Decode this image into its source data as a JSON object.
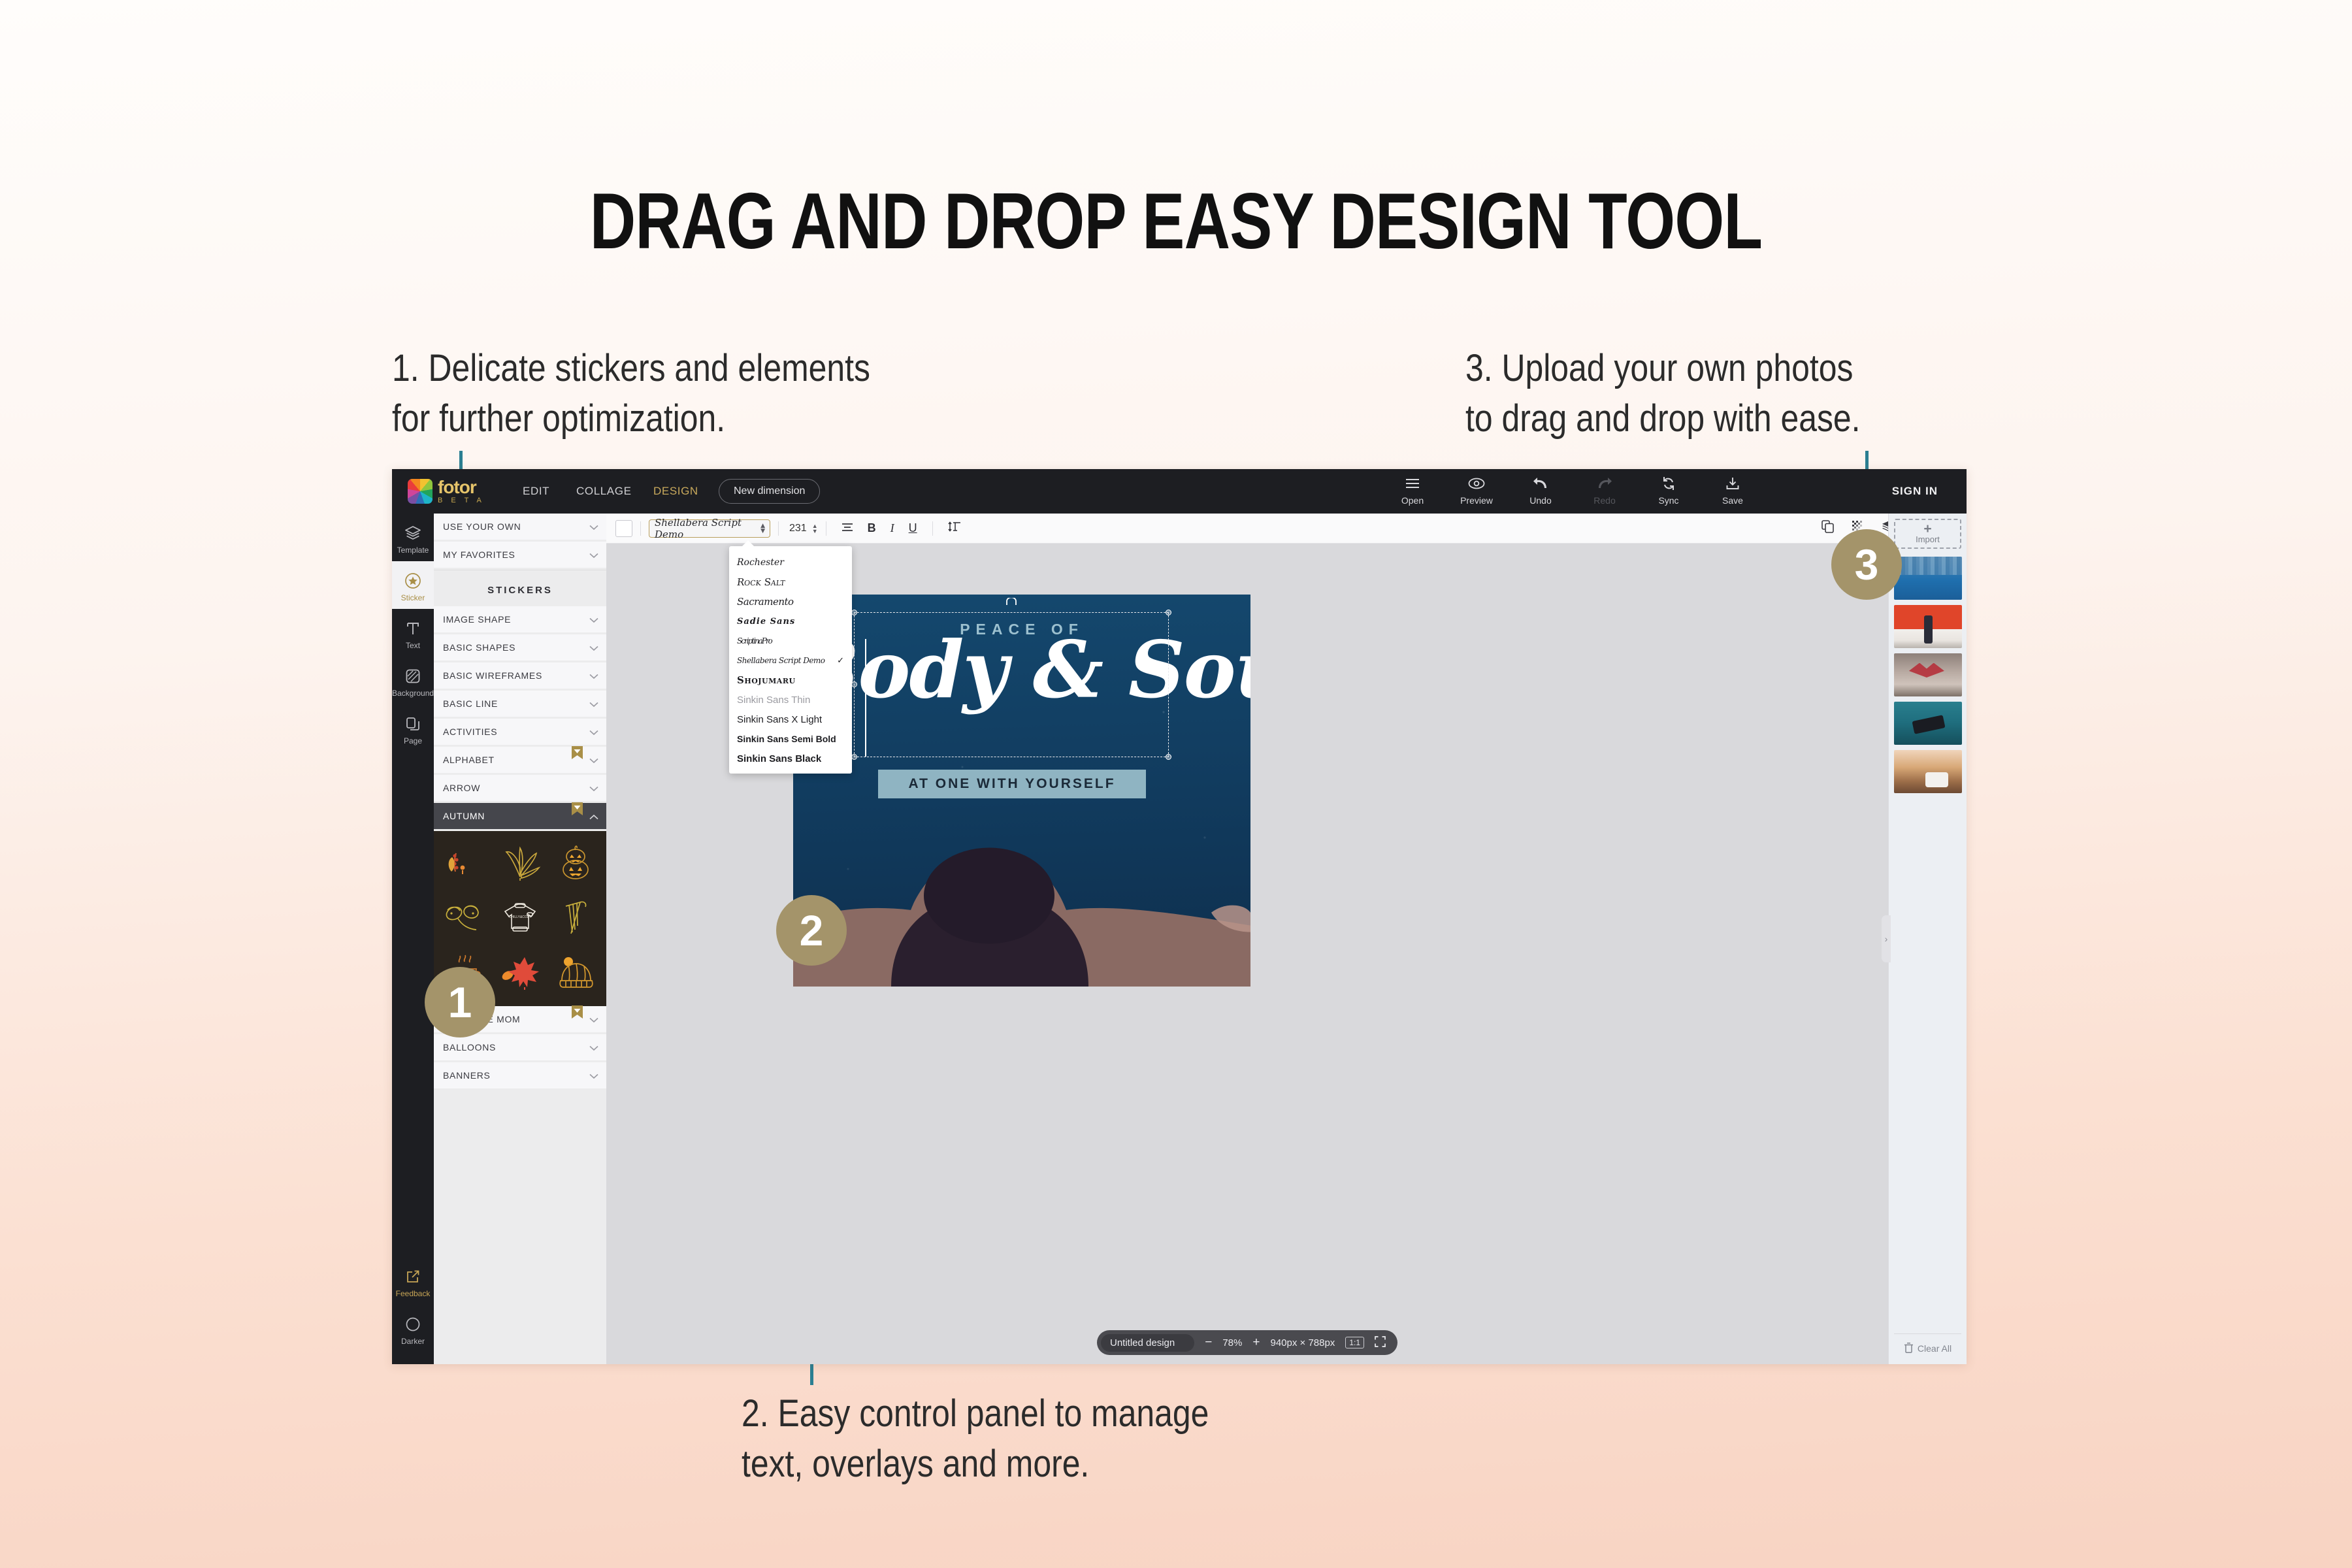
{
  "headline": "DRAG AND DROP EASY DESIGN TOOL",
  "captions": {
    "one": "1. Delicate stickers and elements\nfor further optimization.",
    "two": "2. Easy control panel to manage\ntext, overlays and more.",
    "three": "3. Upload your own photos\nto drag and drop with ease."
  },
  "badges": {
    "one": "1",
    "two": "2",
    "three": "3"
  },
  "colors": {
    "accent_teal": "#2b7f92",
    "badge_gold": "#a4946a",
    "brand_gold": "#c8a95c",
    "topbar_dark": "#1d1e22",
    "canvas_blue": "#123f63",
    "subbar_blue": "#8fb4c2"
  },
  "app": {
    "logo": {
      "name": "fotor",
      "beta": "B E T A"
    },
    "nav": [
      {
        "label": "EDIT",
        "active": false
      },
      {
        "label": "COLLAGE",
        "active": false
      },
      {
        "label": "DESIGN",
        "active": true
      }
    ],
    "new_dimension": "New dimension",
    "tools": [
      {
        "label": "Open",
        "icon": "menu-icon",
        "disabled": false
      },
      {
        "label": "Preview",
        "icon": "eye-icon",
        "disabled": false
      },
      {
        "label": "Undo",
        "icon": "undo-arrow-icon",
        "disabled": false
      },
      {
        "label": "Redo",
        "icon": "redo-arrow-icon",
        "disabled": true
      },
      {
        "label": "Sync",
        "icon": "sync-icon",
        "disabled": false
      },
      {
        "label": "Save",
        "icon": "save-download-icon",
        "disabled": false
      }
    ],
    "sign_in": "SIGN IN",
    "rail": [
      {
        "label": "Template",
        "icon": "layers-icon",
        "selected": false
      },
      {
        "label": "Sticker",
        "icon": "star-badge-icon",
        "selected": true
      },
      {
        "label": "Text",
        "icon": "text-t-icon",
        "selected": false
      },
      {
        "label": "Background",
        "icon": "hatched-square-icon",
        "selected": false
      },
      {
        "label": "Page",
        "icon": "pages-icon",
        "selected": false
      }
    ],
    "rail_bottom": [
      {
        "label": "Feedback",
        "icon": "edit-square-icon"
      },
      {
        "label": "Darker",
        "icon": "moon-contrast-icon"
      }
    ],
    "panel": {
      "top_items": [
        {
          "label": "USE YOUR OWN",
          "premium": false
        },
        {
          "label": "MY FAVORITES",
          "premium": false
        }
      ],
      "section_title": "STICKERS",
      "categories": [
        {
          "label": "IMAGE SHAPE",
          "premium": false,
          "open": false
        },
        {
          "label": "BASIC SHAPES",
          "premium": false,
          "open": false
        },
        {
          "label": "BASIC WIREFRAMES",
          "premium": false,
          "open": false
        },
        {
          "label": "BASIC LINE",
          "premium": false,
          "open": false
        },
        {
          "label": "ACTIVITIES",
          "premium": false,
          "open": false
        },
        {
          "label": "ALPHABET",
          "premium": true,
          "open": false
        },
        {
          "label": "ARROW",
          "premium": false,
          "open": false
        },
        {
          "label": "AUTUMN",
          "premium": true,
          "open": true
        },
        {
          "label": "AWESOME MOM",
          "premium": true,
          "open": false
        },
        {
          "label": "BALLOONS",
          "premium": false,
          "open": false
        },
        {
          "label": "BANNERS",
          "premium": false,
          "open": false
        }
      ],
      "autumn_stickers": [
        "autumn-sprig-sticker",
        "chestnut-leaf-sticker",
        "jack-o-lantern-sticker",
        "acorns-sticker",
        "sweater-sticker",
        "umbrella-sticker",
        "tea-cup-sticker",
        "maple-leaf-sticker",
        "beanie-hat-sticker"
      ]
    },
    "format_bar": {
      "text_color": "#ffffff",
      "font_name": "Shellabera Script Demo",
      "font_size": "231",
      "align_label": "align-icon",
      "bold_label": "B",
      "italic_label": "I",
      "underline_label": "U",
      "line_height_label": "line-height-icon",
      "right_tools": [
        "duplicate-icon",
        "transparency-icon",
        "layers-icon",
        "unlock-icon",
        "delete-trash-icon"
      ]
    },
    "font_menu": [
      {
        "label": "Rochester",
        "cls": "f-script",
        "checked": false
      },
      {
        "label": "Rock Salt",
        "cls": "f-rocksalt",
        "checked": false
      },
      {
        "label": "Sacramento",
        "cls": "f-sac",
        "checked": false
      },
      {
        "label": "Sadie Sans",
        "cls": "f-sadie",
        "checked": false
      },
      {
        "label": "ScriptinaPro",
        "cls": "f-scrip",
        "checked": false
      },
      {
        "label": "Shellabera Script Demo",
        "cls": "f-shella",
        "checked": true
      },
      {
        "label": "Shojumaru",
        "cls": "f-shoju",
        "checked": false
      },
      {
        "label": "Sinkin Sans Thin",
        "cls": "f-thin",
        "checked": false
      },
      {
        "label": "Sinkin Sans X Light",
        "cls": "f-xlight",
        "checked": false
      },
      {
        "label": "Sinkin Sans Semi Bold",
        "cls": "f-semi",
        "checked": false
      },
      {
        "label": "Sinkin Sans Black",
        "cls": "f-black",
        "checked": false
      }
    ],
    "canvas": {
      "line1": "PEACE OF",
      "line2": "Body & Soul",
      "line3": "AT ONE WITH YOURSELF"
    },
    "status": {
      "doc_name": "Untitled design",
      "zoom_out": "−",
      "zoom": "78%",
      "zoom_in": "+",
      "dimensions": "940px × 788px",
      "ratio": "1:1",
      "fullscreen": "fullscreen-icon"
    },
    "import": {
      "drop_label": "Import",
      "plus": "+",
      "thumbnails": [
        "lake-reflection-photo",
        "woman-red-wall-photo",
        "gift-ribbon-photo",
        "hands-camera-photo",
        "woman-coffee-photo"
      ],
      "clear_all": "Clear All",
      "collapse": "›"
    }
  }
}
